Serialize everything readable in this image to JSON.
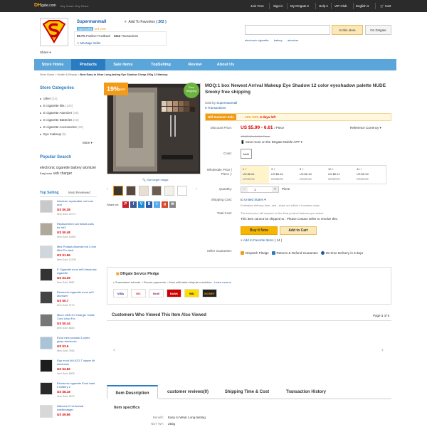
{
  "topbar": {
    "logo_a": "DH",
    "logo_b": "gate.com",
    "slogan": "Buy Smart. Buy Direct.",
    "join": "Join Free",
    "signin": "Sign in",
    "mydhgate": "My DHgate",
    "help": "Help",
    "vip": "VIP Club",
    "lang": "English",
    "cart": "Cart"
  },
  "store": {
    "name": "Supermanmall",
    "add_fav": "Add To Favorites",
    "fav_count": "( 202 )",
    "level_label": "Level",
    "level_value": "Specialist",
    "years": "3rd year",
    "feedback_pct": "99.7%",
    "feedback_label": "Positive Feedback",
    "transactions": "3213",
    "transactions_label": "Transactions",
    "message": "Message Seller",
    "share": "Share"
  },
  "search": {
    "placeholder": "",
    "btn_store": "In this store",
    "btn_dhgate": "On DHgate",
    "hot": [
      "electronic cigarette",
      "battery",
      "atomizer"
    ]
  },
  "nav": {
    "items": [
      "Store Home",
      "Products",
      "Sale Items",
      "TopSelling",
      "Review",
      "About Us"
    ],
    "active": 1
  },
  "breadcrumb": {
    "items": [
      "Store Home",
      "Health & Beauty"
    ],
    "current": "Best Easy to Wear Long-lasting Eye Shadow Cheap 250g 12 Makeup"
  },
  "categories": {
    "title": "Store Categories",
    "items": [
      {
        "name": "other",
        "count": "(14)"
      },
      {
        "name": "E cigarette kits",
        "count": "(125)"
      },
      {
        "name": "E cigarette Atomizer",
        "count": "(45)"
      },
      {
        "name": "E cigarette Batteries",
        "count": "(22)"
      },
      {
        "name": "E cigarette Accessories",
        "count": "(29)"
      },
      {
        "name": "Eye makeup",
        "count": "(5)"
      }
    ],
    "more": "More"
  },
  "popular": {
    "title": "Popular Search",
    "tags": [
      "electronic cigarette",
      "battery",
      "atomizer",
      "Earphone",
      "usb",
      "charger"
    ]
  },
  "topselling": {
    "tab1": "Top Selling",
    "tab2": "Most Reviewed",
    "items": [
      {
        "name": "Atomizer replacable coil core and",
        "price": "US $0.38",
        "sold": "Item Sold: 20771"
      },
      {
        "name": "Replacement coil heads coils for mt3",
        "price": "US $0.48",
        "sold": "Item Sold: 15892"
      },
      {
        "name": "Mini Protank Atomizer kit 2.0ml Mini Pro tank",
        "price": "US $1.96",
        "sold": "Item Sold: 12205"
      },
      {
        "name": "E Cigarette evod mt3 electronic cigarette",
        "price": "US $3.29",
        "sold": "Item Sold: 9881"
      },
      {
        "name": "Electronic cigarette evod mt3 atomizer",
        "price": "US $0.7",
        "sold": "Item Sold: 9774"
      },
      {
        "name": "Micro USB 3.0 Charger Cable Cord Lead For",
        "price": "US $0.44",
        "sold": "Item Sold: 8844"
      },
      {
        "name": "Evod mini protank 3 pyrex glass electronic",
        "price": "US $3.5",
        "sold": "Item Sold: 7554"
      },
      {
        "name": "Ego evod kit UGO-T zipper kit electronic",
        "price": "US $3.82",
        "sold": "Item Sold: 6808"
      },
      {
        "name": "Electronic cigarette Evod twist II battery e",
        "price": "US $8.18",
        "sold": "Item Sold: 6679"
      },
      {
        "name": "Nitecore I2 Universal Intellicharger",
        "price": "US $9.66",
        "sold": ""
      }
    ]
  },
  "product": {
    "badge_pct": "19%",
    "badge_off": "OFF",
    "free": "Free",
    "shipping": "Shipping",
    "see_larger": "See larger image",
    "title": "MOQ:1 box Newest Arrival Makeup Eye Shadow 12 color eyeshadow palette NUDE Smoky free shipping",
    "sold_by_label": "Sold by",
    "sold_by": "Supermanmall",
    "transactions": "6 Transactions",
    "sale_tag": "Hill Summer Sale",
    "sale_off": "19% OFF,",
    "sale_left": "4 days left",
    "discount_label": "Discount Price:",
    "price": "US $5.99 - 6.61",
    "price_unit": "/ Piece",
    "ref_currency": "Reference Currency",
    "old_price": "US $7.39 - 8.16 / Piece",
    "mobile": "Save more on the DHgate Mobile APP",
    "color_label": "Color:",
    "color_value": "Multi",
    "wholesale_label": "Wholesale Price ( Piece ):",
    "wholesale": [
      {
        "q": "1 +",
        "p": "US $6.61",
        "o": "US $8.16"
      },
      {
        "q": "3 +",
        "p": "US $6.52",
        "o": "US $8.05"
      },
      {
        "q": "5 +",
        "p": "US $6.43",
        "o": "US $7.94"
      },
      {
        "q": "10 +",
        "p": "US $6.21",
        "o": "US $7.67"
      },
      {
        "q": "41 +",
        "p": "US $5.99",
        "o": "US $7.39"
      }
    ],
    "quantity_label": "Quantity:",
    "quantity": "1",
    "quantity_unit": "Piece",
    "ship_label": "Shipping Cost:",
    "ship_to_pre": "to",
    "ship_to": "United States",
    "ship_est": "Estimated delivery time: and , ships out within 4 business days",
    "total_label": "Total Cost:",
    "total_desc": "The total price will depend on the final product features you select",
    "total_note": "This item cannot be shipped to . Please contact seller to resolve this.",
    "buy_now": "Buy It Now",
    "add_cart": "Add to Cart",
    "add_fav": "Add to Favorite Items",
    "add_fav_count": "( 14 )",
    "guarantee_label": "Seller Guarantee:",
    "g1": "Dispatch Pledge",
    "g2": "Returns & Refund Guarantee",
    "g3": "On-time Delivery in 8 days",
    "share_label": "Share on:"
  },
  "pledge": {
    "title": "DHgate Service Pledge",
    "items": [
      "Guaranteed refunds",
      "Secure payments",
      "Now with faster dispute resolution"
    ],
    "learn": "Learn more",
    "payments": [
      "VISA",
      "MC",
      "Skrill",
      "BANK",
      "WU",
      "MONEY"
    ]
  },
  "customers_viewed": {
    "title": "Customers Who Viewed This Item Also Viewed",
    "page_label": "Page",
    "page": "1",
    "of": "of",
    "total": "6"
  },
  "tabs": {
    "items": [
      "Item Description",
      "customer reviews(0)",
      "Shipping Time & Cost",
      "Transaction History"
    ],
    "active": 0
  },
  "specs": {
    "title": "Item specifics",
    "rows": [
      {
        "label": "Benefit:",
        "value": "Easy to Wear Long-lasting"
      },
      {
        "label": "NET WT:",
        "value": "250g"
      }
    ]
  }
}
